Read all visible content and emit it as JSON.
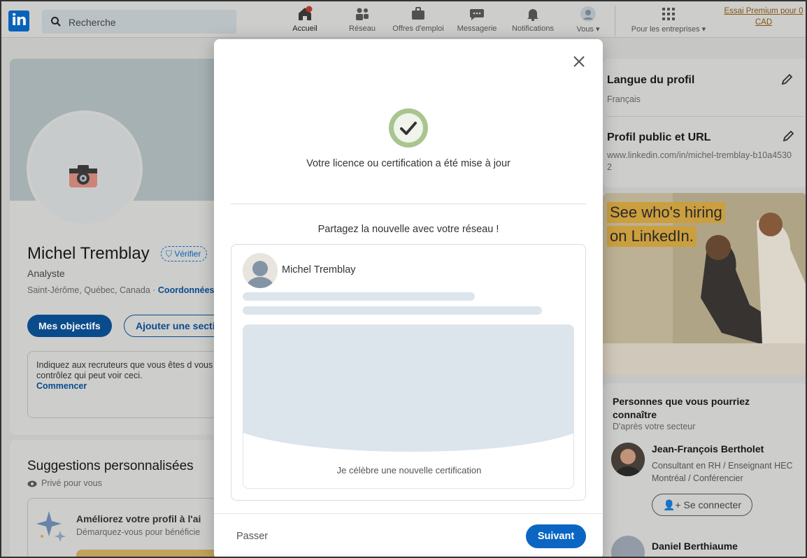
{
  "nav": {
    "logo": "in",
    "search_placeholder": "Recherche",
    "items": [
      {
        "label": "Accueil",
        "icon": "home-icon"
      },
      {
        "label": "Réseau",
        "icon": "network-icon"
      },
      {
        "label": "Offres d'emploi",
        "icon": "briefcase-icon"
      },
      {
        "label": "Messagerie",
        "icon": "message-icon"
      },
      {
        "label": "Notifications",
        "icon": "bell-icon"
      },
      {
        "label": "Vous ▾",
        "icon": "avatar-icon"
      },
      {
        "label": "Pour les entreprises ▾",
        "icon": "grid-icon"
      }
    ],
    "premium": "Essai Premium pour 0 CAD"
  },
  "profile": {
    "name": "Michel Tremblay",
    "verified": "Vérifier",
    "title": "Analyste",
    "location": "Saint-Jérôme, Québec, Canada · ",
    "contact": "Coordonnées",
    "btn_objectives": "Mes objectifs",
    "btn_add_section": "Ajouter une section",
    "recruiters_text": "Indiquez aux recruteurs que vous êtes d vous contrôlez qui peut voir ceci.",
    "recruiters_link": "Commencer"
  },
  "suggestions": {
    "title": "Suggestions personnalisées",
    "subtitle": "Privé pour vous",
    "ai_title": "Améliorez votre profil à l'ai",
    "ai_sub": "Démarquez-vous pour bénéficie"
  },
  "right": {
    "lang_title": "Langue du profil",
    "lang_value": "Français",
    "public_title": "Profil public et URL",
    "public_url": "www.linkedin.com/in/michel-tremblay-b10a45302",
    "ad_line1": "See who's hiring",
    "ad_line2": "on LinkedIn.",
    "pymk_title": "Personnes que vous pourriez connaître",
    "pymk_sub": "D'après votre secteur",
    "person1_name": "Jean-François Bertholet",
    "person1_desc": "Consultant en RH / Enseignant HEC Montréal / Conférencier",
    "connect": "Se connecter",
    "person2_name": "Daniel Berthiaume"
  },
  "modal": {
    "updated": "Votre licence ou certification a été mise à jour",
    "share": "Partagez la nouvelle avec votre réseau !",
    "post_author": "Michel Tremblay",
    "cert_caption": "Je célèbre une nouvelle certification",
    "skip": "Passer",
    "next": "Suivant"
  },
  "colors": {
    "brand": "#0a66c2",
    "success": "#2e7d32"
  }
}
